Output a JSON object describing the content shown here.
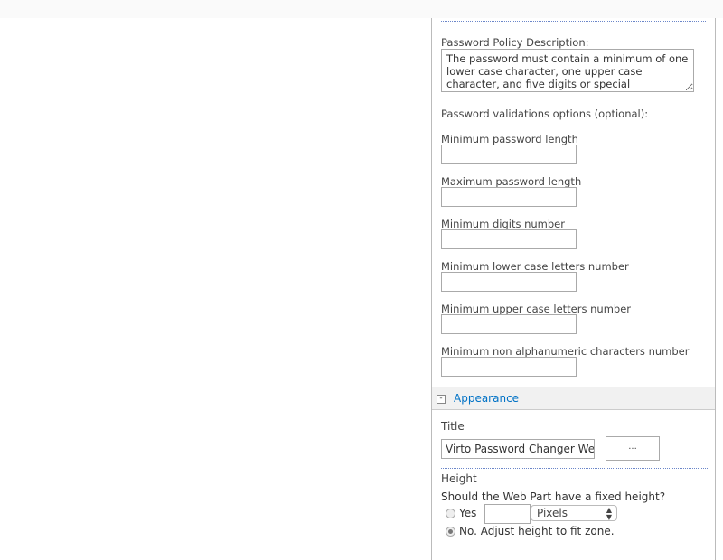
{
  "policy": {
    "description_label": "Password Policy Description:",
    "description_value": "The password must contain a minimum of one lower case character, one upper case character, and five digits or special characters.",
    "validations_label": "Password validations options (optional):",
    "fields": [
      {
        "label": "Minimum password length",
        "value": ""
      },
      {
        "label": "Maximum password length",
        "value": ""
      },
      {
        "label": "Minimum digits number",
        "value": ""
      },
      {
        "label": "Minimum lower case letters number",
        "value": ""
      },
      {
        "label": "Minimum upper case letters number",
        "value": ""
      },
      {
        "label": "Minimum non alphanumeric characters number",
        "value": ""
      }
    ]
  },
  "appearance": {
    "header": "Appearance",
    "title_label": "Title",
    "title_value": "Virto Password Changer Web Part",
    "builder_button": "...",
    "height_label": "Height",
    "height_question": "Should the Web Part have a fixed height?",
    "yes_label": "Yes",
    "height_value": "",
    "unit_selected": "Pixels",
    "no_label": "No. Adjust height to fit zone.",
    "selected_option": "no"
  }
}
